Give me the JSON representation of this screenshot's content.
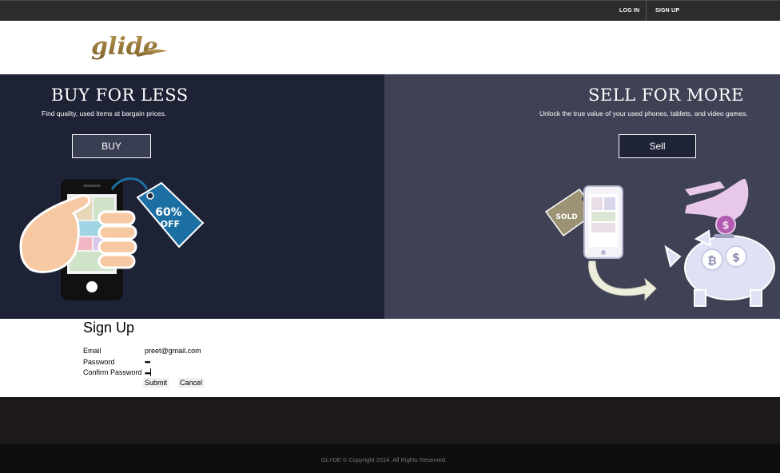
{
  "topbar": {
    "login_label": "LOG IN",
    "signup_label": "SIGN UP"
  },
  "header": {
    "logo_text": "glide"
  },
  "hero": {
    "buy": {
      "title": "BUY FOR LESS",
      "subtitle": "Find quality, used items at bargain prices.",
      "button_label": "BUY",
      "tag_text_line1": "60%",
      "tag_text_line2": "OFF"
    },
    "sell": {
      "title": "SELL FOR MORE",
      "subtitle": "Unlock the true value of your used phones, tablets, and video games.",
      "button_label": "Sell",
      "tag_text": "SOLD"
    }
  },
  "signup": {
    "title": "Sign Up",
    "email_label": "Email",
    "email_value": "preet@gmail.com",
    "password_label": "Password",
    "password_value": "•••",
    "confirm_label": "Confirm Password",
    "confirm_value": "•••",
    "submit_label": "Submit",
    "cancel_label": "Cancel"
  },
  "footer": {
    "copyright": "GLYDE © Copyright 2014. All Rights Reserved."
  },
  "colors": {
    "hero_left_bg": "#1e2235",
    "hero_right_bg": "#3e4254",
    "topbar_bg": "#2c2c2c",
    "logo_gold": "#9a7a3c",
    "tag_blue": "#1c6fa3"
  }
}
